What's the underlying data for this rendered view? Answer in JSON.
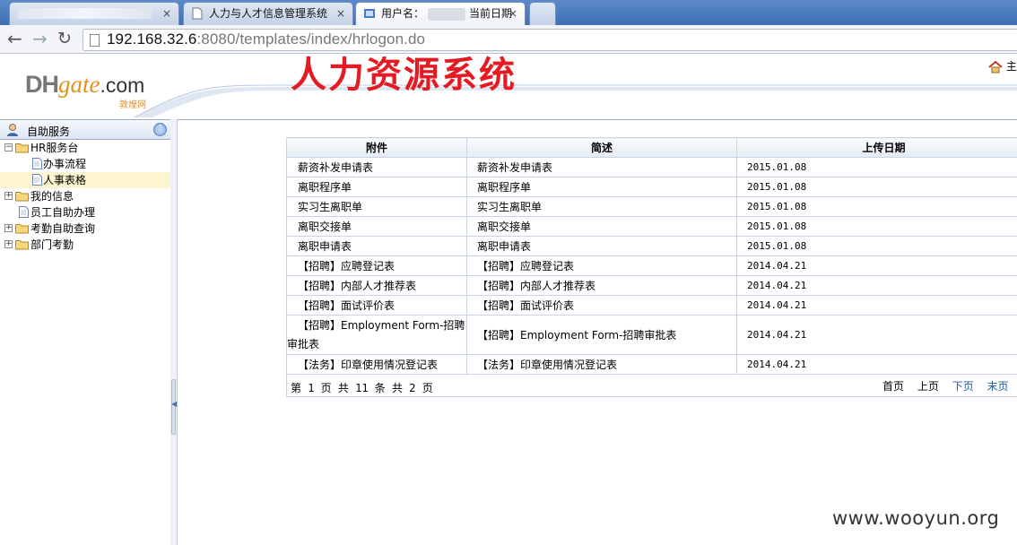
{
  "browser": {
    "tabs": [
      {
        "label": ""
      },
      {
        "label": "人力与人才信息管理系统"
      },
      {
        "label_prefix": "用户名：",
        "label_suffix": "当前日期"
      },
      {
        "label": ""
      }
    ],
    "url_host": "192.168.32.6",
    "url_rest": ":8080/templates/index/hrlogon.do"
  },
  "header": {
    "logo_dh": "DH",
    "logo_gate": "gate",
    "logo_com": ".com",
    "logo_sub": "敦煌网",
    "title": "人力资源系统",
    "home_label": "主"
  },
  "sidebar": {
    "title": "自助服务",
    "tree": [
      {
        "label": "HR服务台",
        "level": 0,
        "type": "folder",
        "expanded": true
      },
      {
        "label": "办事流程",
        "level": 1,
        "type": "doc"
      },
      {
        "label": "人事表格",
        "level": 1,
        "type": "doc",
        "selected": true
      },
      {
        "label": "我的信息",
        "level": 0,
        "type": "folder",
        "expanded": false
      },
      {
        "label": "员工自助办理",
        "level": 0,
        "type": "doc"
      },
      {
        "label": "考勤自助查询",
        "level": 0,
        "type": "folder",
        "expanded": false
      },
      {
        "label": "部门考勤",
        "level": 0,
        "type": "folder",
        "expanded": false
      }
    ]
  },
  "grid": {
    "columns": [
      "附件",
      "简述",
      "上传日期"
    ],
    "rows": [
      {
        "attachment": "薪资补发申请表",
        "summary": "薪资补发申请表",
        "date": "2015.01.08"
      },
      {
        "attachment": "离职程序单",
        "summary": "离职程序单",
        "date": "2015.01.08"
      },
      {
        "attachment": "实习生离职单",
        "summary": "实习生离职单",
        "date": "2015.01.08"
      },
      {
        "attachment": "离职交接单",
        "summary": "离职交接单",
        "date": "2015.01.08"
      },
      {
        "attachment": "离职申请表",
        "summary": "离职申请表",
        "date": "2015.01.08"
      },
      {
        "attachment": "【招聘】应聘登记表",
        "summary": "【招聘】应聘登记表",
        "date": "2014.04.21"
      },
      {
        "attachment": "【招聘】内部人才推荐表",
        "summary": "【招聘】内部人才推荐表",
        "date": "2014.04.21"
      },
      {
        "attachment": "【招聘】面试评价表",
        "summary": "【招聘】面试评价表",
        "date": "2014.04.21"
      },
      {
        "attachment": "【招聘】Employment Form-招聘审批表",
        "summary": "【招聘】Employment Form-招聘审批表",
        "date": "2014.04.21",
        "wrap": true
      },
      {
        "attachment": "【法务】印章使用情况登记表",
        "summary": "【法务】印章使用情况登记表",
        "date": "2014.04.21"
      }
    ]
  },
  "pager": {
    "info": "第 1 页 共 11 条 共 2 页",
    "first": "首页",
    "prev": "上页",
    "next": "下页",
    "last": "末页",
    "extra": "第"
  },
  "watermark": "www.wooyun.org",
  "colors": {
    "header_title": "#e51b24",
    "link_blue": "#1f5fa8",
    "grid_border": "#c9d5e6"
  }
}
